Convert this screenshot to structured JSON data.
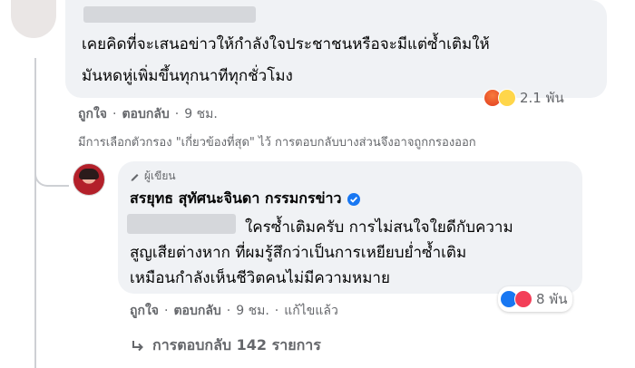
{
  "top_comment": {
    "text_line1": "เคยคิดที่จะเสนอข่าวให้กำลังใจประชาชนหรือจะมีแต่ซ้ำเติมให้",
    "text_line2": "มันหดหู่เพิ่มขึ้นทุกนาทีทุกชั่วโมง",
    "reaction_count": "2.1 พัน",
    "reaction_icons": [
      "angry-icon",
      "haha-icon"
    ],
    "actions": {
      "like": "ถูกใจ",
      "reply": "ตอบกลับ",
      "time": "9 ชม."
    },
    "separator": "·"
  },
  "filter_note": "มีการเลือกตัวกรอง \"เกี่ยวข้องที่สุด\" ไว้ การตอบกลับบางส่วนจึงอาจถูกกรองออก",
  "reply": {
    "author_badge": "ผู้เขียน",
    "author_name": "สรยุทธ สุทัศนะจินดา กรรมกรข่าว",
    "text_line1": "ใครซ้ำเติมครับ การไม่สนใจใยดีกับความ",
    "text_line2": "สูญเสียต่างหาก ที่ผมรู้สึกว่าเป็นการเหยียบย่ำซ้ำเติม",
    "text_line3": "เหมือนกำลังเห็นชีวิตคนไม่มีความหมาย",
    "reaction_count": "8 พัน",
    "reaction_icons": [
      "like-icon",
      "love-icon"
    ],
    "actions": {
      "like": "ถูกใจ",
      "reply": "ตอบกลับ",
      "time": "9 ชม.",
      "edited": "แก้ไขแล้ว"
    },
    "separator": "·"
  },
  "more_replies": "การตอบกลับ 142 รายการ",
  "colors": {
    "bubble": "#f0f2f5",
    "secondary_text": "#65676b",
    "verified": "#1877f2"
  }
}
